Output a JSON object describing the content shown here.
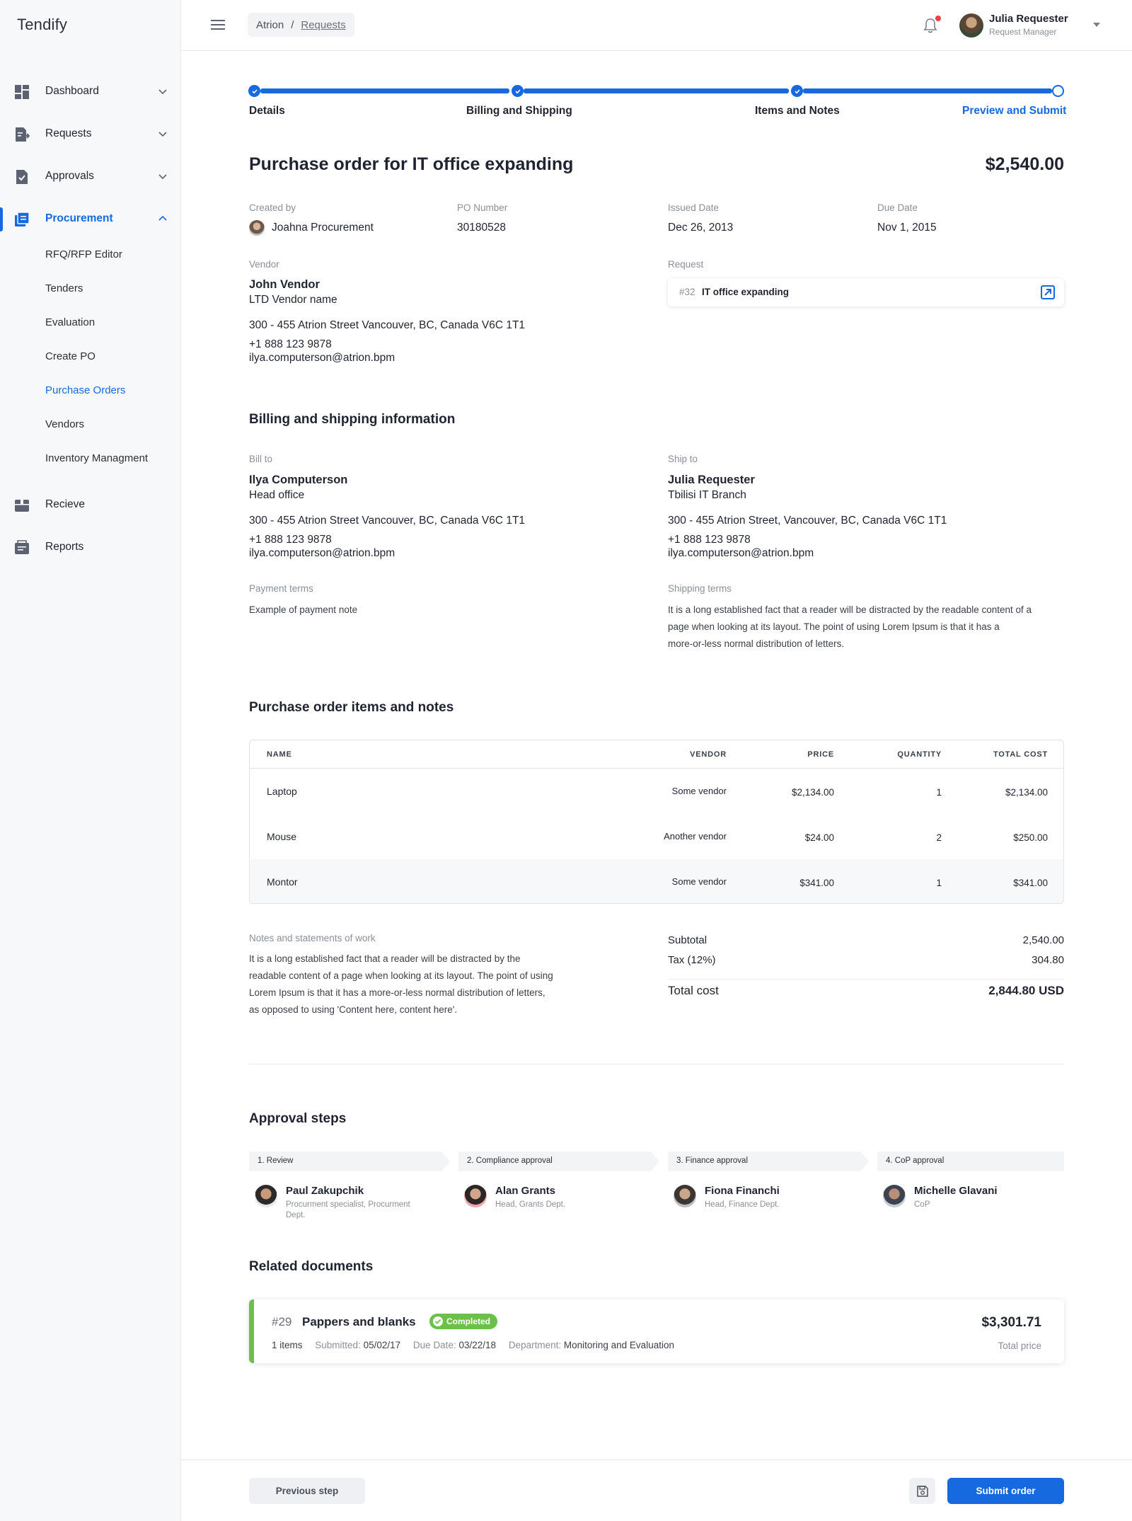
{
  "app": {
    "brand": "Tendify"
  },
  "sidebar": {
    "items": [
      {
        "label": "Dashboard",
        "icon": "dashboard-icon"
      },
      {
        "label": "Requests",
        "icon": "requests-icon"
      },
      {
        "label": "Approvals",
        "icon": "approvals-icon"
      },
      {
        "label": "Procurement",
        "icon": "procurement-icon"
      },
      {
        "label": "Recieve",
        "icon": "receive-icon"
      },
      {
        "label": "Reports",
        "icon": "reports-icon"
      }
    ],
    "sub_items": [
      "RFQ/RFP Editor",
      "Tenders",
      "Evaluation",
      "Create PO",
      "Purchase Orders",
      "Vendors",
      "Inventory Managment"
    ],
    "accent": "#1769e0"
  },
  "topbar": {
    "breadcrumb": [
      "Atrion",
      "Requests"
    ],
    "user_name": "Julia Requester",
    "user_role": "Request Manager"
  },
  "stepper": {
    "steps": [
      "Details",
      "Billing and Shipping",
      "Items and Notes",
      "Preview and Submit"
    ]
  },
  "po": {
    "title": "Purchase order for IT office expanding",
    "amount": "$2,540.00",
    "created_by_label": "Created by",
    "created_by": "Joahna Procurement",
    "po_number_label": "PO Number",
    "po_number": "30180528",
    "issued_label": "Issued Date",
    "issued": "Dec 26, 2013",
    "due_label": "Due Date",
    "due": "Nov 1, 2015",
    "vendor_label": "Vendor",
    "vendor_name": "John Vendor",
    "vendor_sub": "LTD Vendor name",
    "vendor_address": "300 - 455 Atrion Street Vancouver, BC, Canada V6C 1T1",
    "vendor_phone": "+1 888 123 9878",
    "vendor_email": "ilya.computerson@atrion.bpm",
    "request_label": "Request",
    "request_num": "#32",
    "request_name": "IT office expanding"
  },
  "billing": {
    "title": "Billing and shipping information",
    "bill_label": "Bill to",
    "bill_name": "Ilya Computerson",
    "bill_sub": "Head office",
    "bill_address": "300 - 455 Atrion Street Vancouver, BC, Canada V6C 1T1",
    "bill_phone": "+1 888 123 9878",
    "bill_email": "ilya.computerson@atrion.bpm",
    "ship_label": "Ship to",
    "ship_name": "Julia Requester",
    "ship_sub": "Tbilisi IT Branch",
    "ship_address": "300 - 455 Atrion Street, Vancouver, BC, Canada V6C 1T1",
    "ship_phone": "+1 888 123 9878",
    "ship_email": "ilya.computerson@atrion.bpm",
    "payment_label": "Payment terms",
    "payment_text": "Example of payment note",
    "shipping_label": "Shipping terms",
    "shipping_lines": [
      "It is a long established fact that a reader will be distracted by the readable content of a",
      "page when looking at its layout. The point of using Lorem Ipsum is that it has a",
      "more-or-less normal distribution of letters."
    ]
  },
  "items": {
    "title": "Purchase order items and notes",
    "columns": [
      "NAME",
      "VENDOR",
      "PRICE",
      "QUANTITY",
      "TOTAL COST"
    ],
    "rows": [
      [
        "Laptop",
        "Some vendor",
        "$2,134.00",
        "1",
        "$2,134.00"
      ],
      [
        "Mouse",
        "Another vendor",
        "$24.00",
        "2",
        "$250.00"
      ],
      [
        "Montor",
        "Some vendor",
        "$341.00",
        "1",
        "$341.00"
      ]
    ],
    "notes_label": "Notes and statements of work",
    "notes_lines": [
      "It is a long established fact that a reader will be distracted by the",
      "readable content of a page when looking at its layout. The point of using",
      "Lorem Ipsum is that it has a more-or-less normal distribution of letters,",
      "as opposed to using 'Content here, content here'."
    ],
    "subtotal_label": "Subtotal",
    "subtotal": "2,540.00",
    "tax_label": "Tax (12%)",
    "tax": "304.80",
    "total_label": "Total cost",
    "total": "2,844.80 USD"
  },
  "approvals": {
    "title": "Approval steps",
    "steps": [
      {
        "label": "1. Review",
        "name": "Paul Zakupchik",
        "role_lines": [
          "Procurment specialist, Procurment",
          "Dept."
        ]
      },
      {
        "label": "2. Compliance  approval",
        "name": "Alan Grants",
        "role_lines": [
          "Head, Grants Dept."
        ]
      },
      {
        "label": "3. Finance approval",
        "name": "Fiona Financhi",
        "role_lines": [
          "Head, Finance Dept."
        ]
      },
      {
        "label": "4. CoP approval",
        "name": "Michelle Glavani",
        "role_lines": [
          "CoP"
        ]
      }
    ]
  },
  "related": {
    "title": "Related documents",
    "doc": {
      "num": "#29",
      "title": "Pappers and blanks",
      "status": "Completed",
      "status_color": "#6cc04a",
      "items": "1 items",
      "submitted_label": "Submitted:",
      "submitted": "05/02/17",
      "due_label": "Due Date:",
      "due": "03/22/18",
      "dept_label": "Department:",
      "dept": "Monitoring and Evaluation",
      "price": "$3,301.71",
      "price_label": "Total price"
    }
  },
  "footer": {
    "prev": "Previous step",
    "submit": "Submit order"
  }
}
